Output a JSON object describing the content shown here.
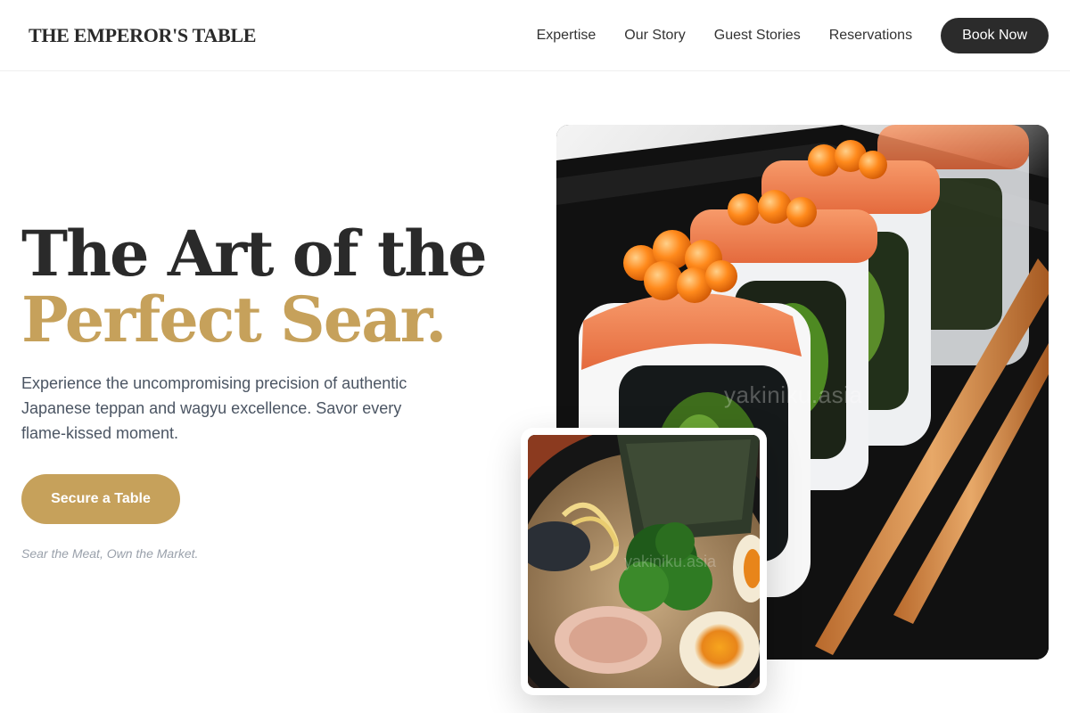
{
  "header": {
    "brand": "THE EMPEROR'S TABLE",
    "nav": [
      "Expertise",
      "Our Story",
      "Guest Stories",
      "Reservations"
    ],
    "book_button": "Book Now"
  },
  "hero": {
    "title_line1": "The Art of the",
    "title_line2": "Perfect Sear.",
    "description": "Experience the uncompromising precision of authentic Japanese teppan and wagyu excellence. Savor every flame-kissed moment.",
    "cta": "Secure a Table",
    "tagline": "Sear the Meat, Own the Market."
  },
  "images": {
    "main_watermark": "yakiniku.asia",
    "inset_watermark": "yakiniku.asia"
  },
  "colors": {
    "accent": "#c6a15b",
    "dark": "#2b2b2b",
    "text_muted": "#4b5563",
    "tagline": "#9aa1ab"
  }
}
